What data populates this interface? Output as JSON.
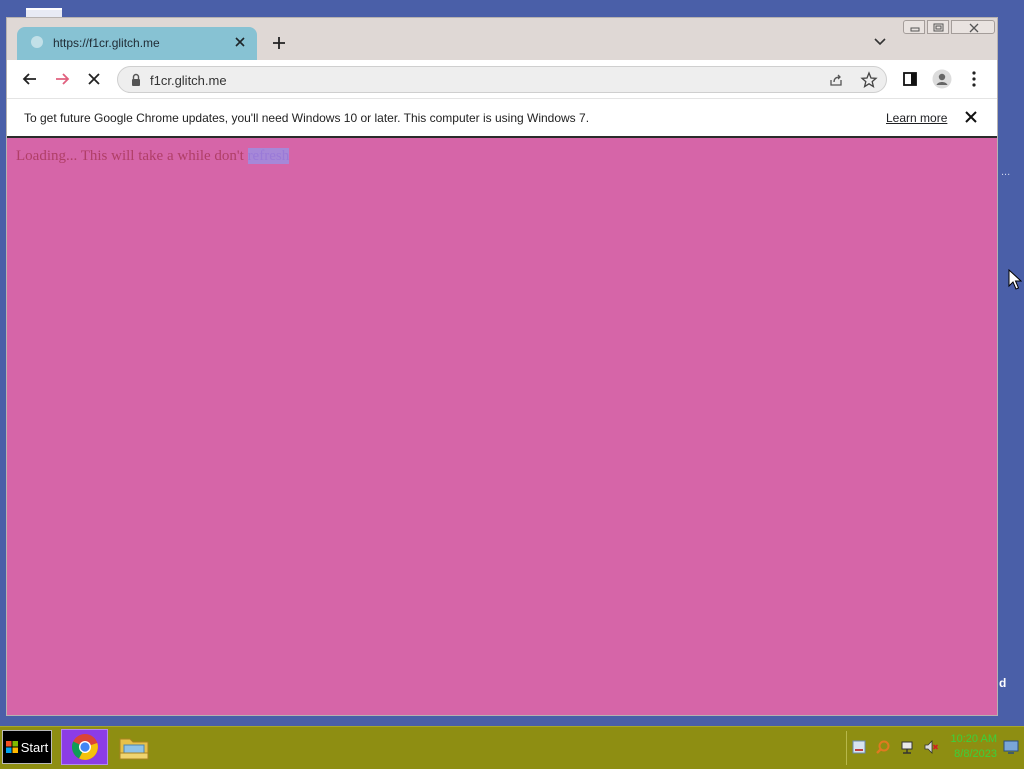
{
  "browser": {
    "tab": {
      "title": "https://f1cr.glitch.me",
      "close_icon": "close-icon"
    },
    "new_tab_icon": "plus-icon",
    "url": "f1cr.glitch.me",
    "infobar": {
      "message": "To get future Google Chrome updates, you'll need Windows 10 or later. This computer is using Windows 7.",
      "link": "Learn more"
    }
  },
  "page": {
    "loading_text": "Loading... This will take a while don't ",
    "selected_word": "refresh"
  },
  "taskbar": {
    "start_label": "Start",
    "time": "10:20 AM",
    "date": "8/8/2023"
  },
  "desktop": {
    "fragment_right_top": "...",
    "fragment_right_bottom": "d"
  },
  "colors": {
    "desktop_bg": "#4a5fa8",
    "tab_bg": "#87c2d3",
    "page_bg": "#d665a8",
    "taskbar_bg": "#8e8e12",
    "clock_text": "#3bd13b"
  }
}
